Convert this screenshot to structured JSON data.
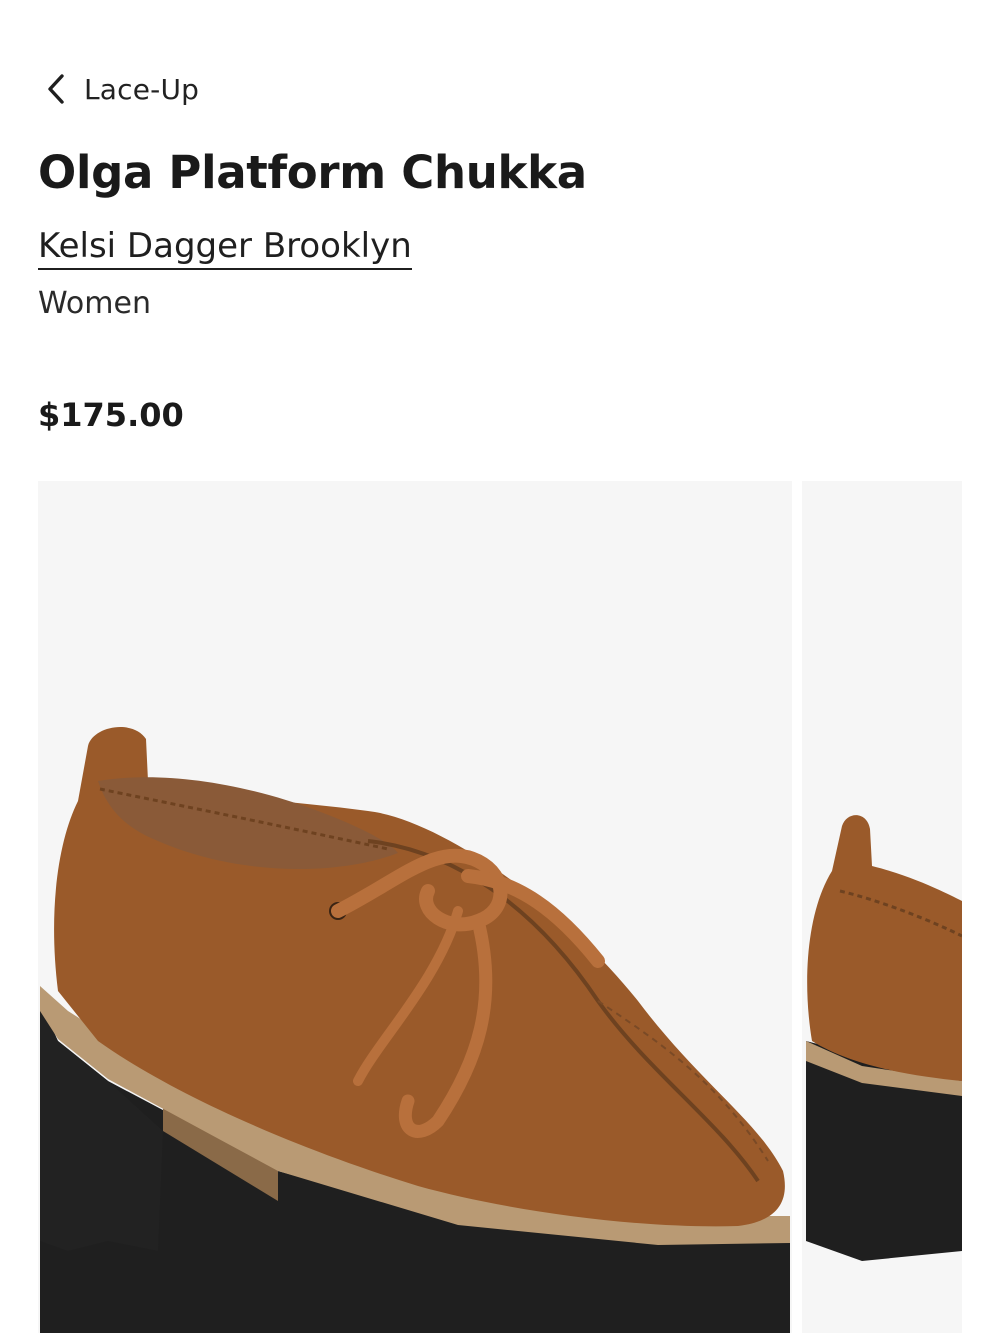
{
  "breadcrumb": {
    "back_label": "Lace-Up",
    "icon": "chevron-left-icon"
  },
  "product": {
    "title": "Olga Platform Chukka",
    "brand": "Kelsi Dagger Brooklyn",
    "category": "Women",
    "price": "$175.00"
  },
  "gallery": {
    "images": [
      {
        "depicts": "brown suede platform chukka shoe with velvet laces, three-quarter view"
      },
      {
        "depicts": "brown suede platform chukka shoe, rear view (partially visible)"
      }
    ]
  },
  "colors": {
    "suede": "#9a5a2a",
    "lace": "#b8703c",
    "sole": "#1f1f1f",
    "welt": "#b99a74",
    "photo_bg": "#f6f6f6"
  }
}
